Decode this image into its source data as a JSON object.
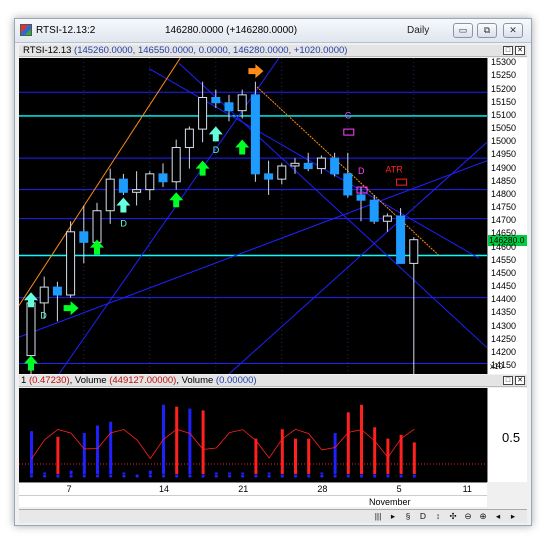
{
  "window": {
    "title": "RTSI-12.13:2",
    "center_title": "146280.0000 (+146280.0000)",
    "period": "Daily",
    "buttons": {
      "minimize": "▭",
      "restore": "⧉",
      "close": "✕"
    }
  },
  "price_pane": {
    "header_symbol": "RTSI-12.13",
    "header_values": "(145260.0000, 146550.0000, 0.0000, 146280.0000, +1020.0000)",
    "axis_ticks": [
      "15300",
      "15250",
      "15200",
      "15150",
      "15100",
      "15050",
      "15000",
      "14950",
      "14900",
      "14850",
      "14800",
      "14750",
      "14700",
      "14650",
      "14600",
      "14550",
      "14500",
      "14450",
      "14400",
      "14350",
      "14300",
      "14250",
      "14200",
      "14150"
    ],
    "last_price_box": "146280.0",
    "scale_label": "x10",
    "labels": {
      "atr": "ATR",
      "d": "D",
      "c": "C"
    }
  },
  "volume_pane": {
    "header_num": "1",
    "header_val1": "(0.47230)",
    "header_vol_label": "Volume",
    "header_vol_val": "(449127.00000)",
    "header_vol2_val": "(0.00000)",
    "axis_tick": "0.5"
  },
  "x_axis": {
    "dates": [
      "7",
      "14",
      "21",
      "28",
      "5",
      "11"
    ],
    "month": "November"
  },
  "toolbar": {
    "items": [
      "|||",
      "▸",
      "§",
      "D",
      "↕",
      "✣",
      "⊖",
      "⊕",
      "◂",
      "▸"
    ]
  },
  "colors": {
    "up_candle": "#1e9bff",
    "down_candle": "#1e9bff",
    "cyan_line": "#00ffff",
    "blue_line": "#2020ff",
    "trend_orange": "#ff8c1a",
    "green_arrow": "#00ff22",
    "volume_red": "#ff2020",
    "volume_blue": "#2020ff"
  },
  "chart_data": {
    "type": "candlestick",
    "title": "RTSI-12.13",
    "ylim": [
      14120,
      15320
    ],
    "scale_note": "x10",
    "x_date_labels": [
      "7",
      "14",
      "21",
      "28",
      "5",
      "11"
    ],
    "candles": [
      {
        "o": 14190,
        "h": 14420,
        "l": 14120,
        "c": 14390
      },
      {
        "o": 14390,
        "h": 14490,
        "l": 14330,
        "c": 14450
      },
      {
        "o": 14450,
        "h": 14470,
        "l": 14320,
        "c": 14420
      },
      {
        "o": 14420,
        "h": 14700,
        "l": 14410,
        "c": 14660
      },
      {
        "o": 14660,
        "h": 14760,
        "l": 14540,
        "c": 14620
      },
      {
        "o": 14620,
        "h": 14770,
        "l": 14600,
        "c": 14740
      },
      {
        "o": 14740,
        "h": 14900,
        "l": 14690,
        "c": 14860
      },
      {
        "o": 14860,
        "h": 14880,
        "l": 14800,
        "c": 14810
      },
      {
        "o": 14810,
        "h": 14890,
        "l": 14760,
        "c": 14820
      },
      {
        "o": 14820,
        "h": 14890,
        "l": 14780,
        "c": 14880
      },
      {
        "o": 14880,
        "h": 14920,
        "l": 14830,
        "c": 14850
      },
      {
        "o": 14850,
        "h": 15010,
        "l": 14820,
        "c": 14980
      },
      {
        "o": 14980,
        "h": 15060,
        "l": 14900,
        "c": 15050
      },
      {
        "o": 15050,
        "h": 15230,
        "l": 15000,
        "c": 15170
      },
      {
        "o": 15170,
        "h": 15200,
        "l": 15130,
        "c": 15150
      },
      {
        "o": 15150,
        "h": 15180,
        "l": 15080,
        "c": 15120
      },
      {
        "o": 15120,
        "h": 15200,
        "l": 15090,
        "c": 15180
      },
      {
        "o": 15180,
        "h": 15230,
        "l": 14850,
        "c": 14880
      },
      {
        "o": 14880,
        "h": 14930,
        "l": 14800,
        "c": 14860
      },
      {
        "o": 14860,
        "h": 14920,
        "l": 14840,
        "c": 14910
      },
      {
        "o": 14910,
        "h": 14940,
        "l": 14880,
        "c": 14920
      },
      {
        "o": 14920,
        "h": 14960,
        "l": 14890,
        "c": 14900
      },
      {
        "o": 14900,
        "h": 14950,
        "l": 14880,
        "c": 14940
      },
      {
        "o": 14940,
        "h": 14960,
        "l": 14870,
        "c": 14880
      },
      {
        "o": 14880,
        "h": 14960,
        "l": 14790,
        "c": 14800
      },
      {
        "o": 14800,
        "h": 14830,
        "l": 14700,
        "c": 14780
      },
      {
        "o": 14780,
        "h": 14800,
        "l": 14690,
        "c": 14700
      },
      {
        "o": 14700,
        "h": 14730,
        "l": 14660,
        "c": 14720
      },
      {
        "o": 14720,
        "h": 14750,
        "l": 14640,
        "c": 14540
      },
      {
        "o": 14540,
        "h": 14640,
        "l": 14100,
        "c": 14630
      }
    ],
    "horizontal_levels": [
      {
        "price": 15190,
        "color": "#2020ff"
      },
      {
        "price": 15100,
        "color": "#00ffff"
      },
      {
        "price": 14940,
        "color": "#2020ff"
      },
      {
        "price": 14820,
        "color": "#2020ff"
      },
      {
        "price": 14710,
        "color": "#2020ff"
      },
      {
        "price": 14570,
        "color": "#00ffff"
      },
      {
        "price": 14410,
        "color": "#2020ff"
      },
      {
        "price": 14160,
        "color": "#2020ff"
      }
    ],
    "volume": [
      {
        "v": 0.52,
        "c": "blue"
      },
      {
        "v": 0.08,
        "c": "blue"
      },
      {
        "v": 0.46,
        "c": "red"
      },
      {
        "v": 0.1,
        "c": "blue"
      },
      {
        "v": 0.5,
        "c": "blue"
      },
      {
        "v": 0.58,
        "c": "blue"
      },
      {
        "v": 0.62,
        "c": "blue"
      },
      {
        "v": 0.08,
        "c": "blue"
      },
      {
        "v": 0.06,
        "c": "blue"
      },
      {
        "v": 0.1,
        "c": "blue"
      },
      {
        "v": 0.8,
        "c": "blue"
      },
      {
        "v": 0.78,
        "c": "red"
      },
      {
        "v": 0.76,
        "c": "blue"
      },
      {
        "v": 0.74,
        "c": "red"
      },
      {
        "v": 0.08,
        "c": "blue"
      },
      {
        "v": 0.08,
        "c": "blue"
      },
      {
        "v": 0.08,
        "c": "blue"
      },
      {
        "v": 0.44,
        "c": "red"
      },
      {
        "v": 0.08,
        "c": "blue"
      },
      {
        "v": 0.54,
        "c": "red"
      },
      {
        "v": 0.44,
        "c": "red"
      },
      {
        "v": 0.44,
        "c": "red"
      },
      {
        "v": 0.08,
        "c": "blue"
      },
      {
        "v": 0.5,
        "c": "blue"
      },
      {
        "v": 0.72,
        "c": "red"
      },
      {
        "v": 0.8,
        "c": "red"
      },
      {
        "v": 0.56,
        "c": "red"
      },
      {
        "v": 0.44,
        "c": "red"
      },
      {
        "v": 0.48,
        "c": "red"
      },
      {
        "v": 0.4,
        "c": "red"
      }
    ]
  }
}
